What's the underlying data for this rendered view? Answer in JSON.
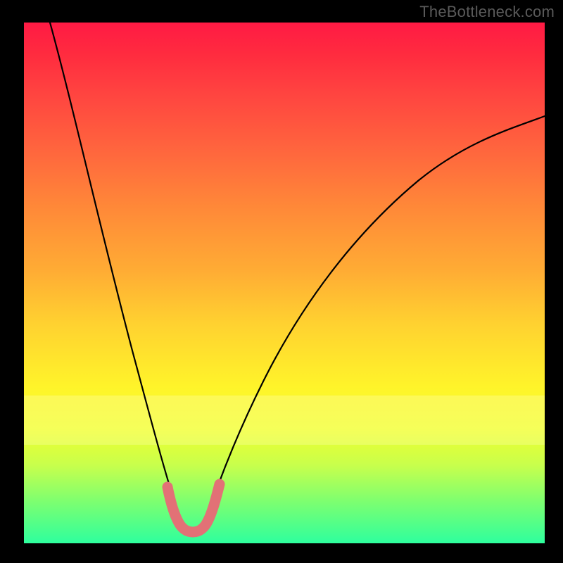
{
  "watermark": "TheBottleneck.com",
  "colors": {
    "background": "#000000",
    "curve": "#000000",
    "marker": "#e27176",
    "watermark_text": "#5a5a5a"
  },
  "chart_data": {
    "type": "line",
    "title": "",
    "xlabel": "",
    "ylabel": "",
    "x_range": [
      0,
      1
    ],
    "y_range": [
      0,
      1
    ],
    "series": [
      {
        "name": "left-branch",
        "x": [
          0.05,
          0.08,
          0.11,
          0.14,
          0.17,
          0.2,
          0.225,
          0.25,
          0.27,
          0.29,
          0.305
        ],
        "y": [
          1.0,
          0.87,
          0.74,
          0.6,
          0.47,
          0.34,
          0.245,
          0.165,
          0.105,
          0.055,
          0.03
        ]
      },
      {
        "name": "right-branch",
        "x": [
          0.345,
          0.37,
          0.4,
          0.44,
          0.49,
          0.55,
          0.63,
          0.72,
          0.82,
          0.92,
          1.0
        ],
        "y": [
          0.03,
          0.075,
          0.145,
          0.24,
          0.345,
          0.45,
          0.555,
          0.645,
          0.72,
          0.78,
          0.82
        ]
      },
      {
        "name": "valley-marker",
        "x": [
          0.275,
          0.285,
          0.295,
          0.305,
          0.315,
          0.325,
          0.335,
          0.345,
          0.355,
          0.365,
          0.375
        ],
        "y": [
          0.11,
          0.075,
          0.05,
          0.035,
          0.028,
          0.026,
          0.028,
          0.035,
          0.05,
          0.075,
          0.11
        ]
      }
    ],
    "grid": false,
    "legend": false,
    "valley_x": 0.325,
    "pale_band_y": [
      0.19,
      0.28
    ]
  }
}
